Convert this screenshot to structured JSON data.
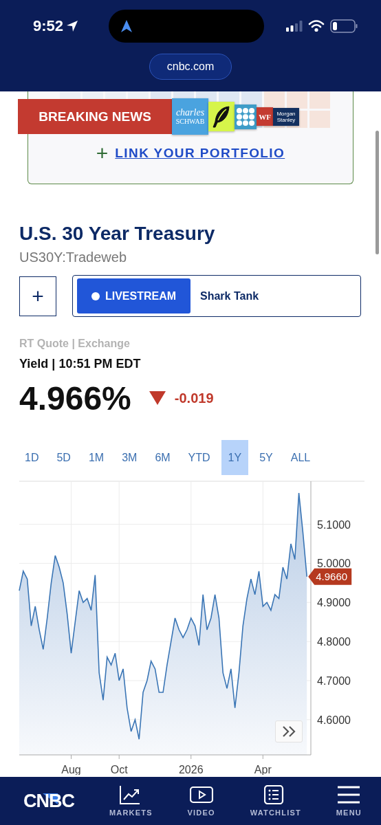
{
  "status_bar": {
    "time": "9:52"
  },
  "browser": {
    "url": "cnbc.com"
  },
  "portfolio_promo": {
    "banner": "BREAKING NEWS",
    "logos": [
      {
        "kind": "schwab",
        "lines": [
          "charles",
          "SCHWAB"
        ]
      },
      {
        "kind": "feather"
      },
      {
        "kind": "dots"
      },
      {
        "kind": "wf",
        "text": "WF"
      },
      {
        "kind": "ms",
        "lines": [
          "Morgan",
          "Stanley"
        ]
      }
    ],
    "link_icon": "+",
    "link": "LINK YOUR PORTFOLIO"
  },
  "quote": {
    "title": "U.S. 30 Year Treasury",
    "symbol": "US30Y:Tradeweb",
    "add_button": "+",
    "livestream": {
      "label": "LIVESTREAM",
      "show": "Shark Tank"
    },
    "source": "RT Quote | Exchange",
    "time_line": "Yield | 10:51 PM EDT",
    "price": "4.966%",
    "change_negative": true,
    "change": "-0.019"
  },
  "ranges": [
    {
      "label": "1D",
      "selected": false
    },
    {
      "label": "5D",
      "selected": false
    },
    {
      "label": "1M",
      "selected": false
    },
    {
      "label": "3M",
      "selected": false
    },
    {
      "label": "6M",
      "selected": false
    },
    {
      "label": "YTD",
      "selected": false
    },
    {
      "label": "1Y",
      "selected": true
    },
    {
      "label": "5Y",
      "selected": false
    },
    {
      "label": "ALL",
      "selected": false
    }
  ],
  "chart": {
    "chart_data": {
      "type": "area",
      "grid": true,
      "ylim": [
        4.51,
        5.21
      ],
      "categories": [
        null,
        null,
        null,
        null,
        null,
        null,
        null,
        null,
        null,
        null,
        null,
        null,
        null,
        "Aug",
        null,
        null,
        null,
        null,
        null,
        null,
        null,
        null,
        null,
        null,
        null,
        "Oct",
        null,
        null,
        null,
        null,
        null,
        null,
        null,
        null,
        null,
        null,
        null,
        null,
        null,
        null,
        null,
        null,
        null,
        "2026",
        null,
        null,
        null,
        null,
        null,
        null,
        null,
        null,
        null,
        null,
        null,
        null,
        null,
        null,
        null,
        null,
        null,
        "Apr",
        null,
        null,
        null,
        null,
        null,
        null,
        null,
        null,
        null,
        null,
        null
      ],
      "yticks": [
        {
          "value": 4.6,
          "label": "4.6000"
        },
        {
          "value": 4.7,
          "label": "4.7000"
        },
        {
          "value": 4.8,
          "label": "4.8000"
        },
        {
          "value": 4.9,
          "label": "4.9000"
        },
        {
          "value": 5.0,
          "label": "5.0000"
        },
        {
          "value": 5.1,
          "label": "5.1000"
        }
      ],
      "series": [
        {
          "color": "#3a75b5",
          "values": [
            4.93,
            4.98,
            4.96,
            4.84,
            4.89,
            4.83,
            4.78,
            4.86,
            4.95,
            5.02,
            4.99,
            4.95,
            4.87,
            4.77,
            4.85,
            4.93,
            4.9,
            4.91,
            4.88,
            4.97,
            4.72,
            4.65,
            4.76,
            4.74,
            4.77,
            4.7,
            4.73,
            4.63,
            4.57,
            4.6,
            4.55,
            4.67,
            4.7,
            4.75,
            4.73,
            4.67,
            4.67,
            4.74,
            4.8,
            4.86,
            4.83,
            4.81,
            4.83,
            4.86,
            4.84,
            4.79,
            4.92,
            4.83,
            4.86,
            4.92,
            4.86,
            4.72,
            4.68,
            4.73,
            4.63,
            4.72,
            4.84,
            4.91,
            4.96,
            4.92,
            4.98,
            4.89,
            4.9,
            4.88,
            4.92,
            4.91,
            4.99,
            4.96,
            5.05,
            5.01,
            5.18,
            5.08,
            4.966
          ]
        }
      ],
      "annotations": [
        "4.9660"
      ]
    }
  },
  "bottom_nav": {
    "logo": "CNBC",
    "items": [
      {
        "kind": "markets",
        "label": "MARKETS"
      },
      {
        "kind": "video",
        "label": "VIDEO"
      },
      {
        "kind": "watchlist",
        "label": "WATCHLIST"
      },
      {
        "kind": "menu",
        "label": "MENU"
      }
    ]
  }
}
